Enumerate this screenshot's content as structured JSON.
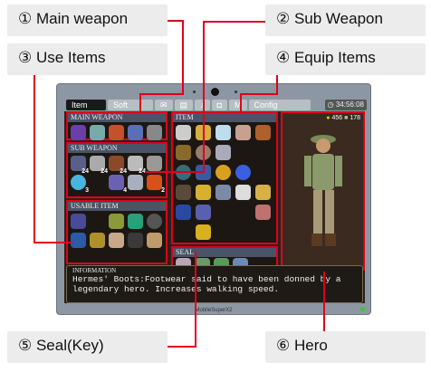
{
  "callouts": {
    "main_weapon": "① Main weapon",
    "sub_weapon": "② Sub Weapon",
    "use_items": "③ Use Items",
    "equip_items": "④ Equip Items",
    "seal": "⑤ Seal(Key)",
    "hero": "⑥ Hero"
  },
  "tabs": [
    "Item",
    "Soft",
    "✉",
    "▤",
    "♪",
    "◘",
    "M",
    "Config"
  ],
  "clock": "34:56:08",
  "hero_stats": {
    "coins": "456",
    "weights": "178"
  },
  "panels": {
    "main_weapon": "MAIN WEAPON",
    "sub_weapon": "SUB WEAPON",
    "usable_item": "USABLE ITEM",
    "item": "ITEM",
    "seal": "SEAL"
  },
  "sub_weapon_counts": [
    "24",
    "24",
    "24",
    "24",
    "",
    "3",
    "",
    "4",
    "",
    "2"
  ],
  "information": {
    "heading": "INFORMATION",
    "text": "Hermes' Boots:Footwear said to have been donned by a legendary hero. Increases walking speed."
  },
  "device_label": "MobileSuperX2",
  "colors": {
    "callout_line": "#e0001a",
    "panel_title": "#4a5468"
  }
}
